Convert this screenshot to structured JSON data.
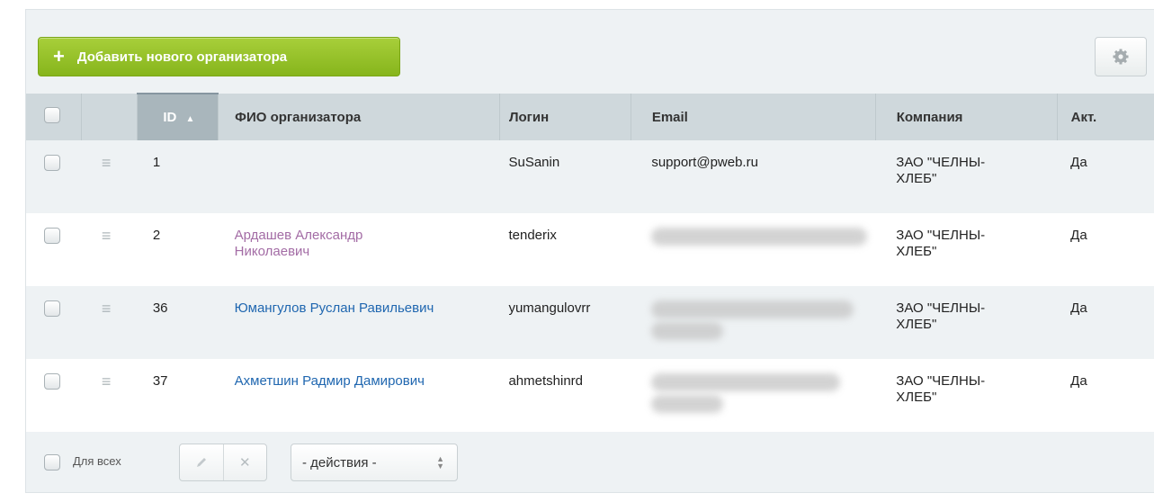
{
  "toolbar": {
    "add_button_label": "Добавить нового организатора",
    "add_button_icon": "plus-icon",
    "settings_icon": "gear-icon"
  },
  "table": {
    "columns": [
      "",
      "",
      "ID",
      "ФИО организатора",
      "Логин",
      "Email",
      "Компания",
      "Акт."
    ],
    "sort_indicator": "▲",
    "rows": [
      {
        "id": "1",
        "name": "",
        "name_visited": false,
        "login": "SuSanin",
        "email": "support@pweb.ru",
        "email_hidden": false,
        "company": "ЗАО \"ЧЕЛНЫ-ХЛЕБ\"",
        "active": "Да"
      },
      {
        "id": "2",
        "name": "Ардашев Александр Николаевич",
        "name_visited": true,
        "login": "tenderix",
        "email": "",
        "email_hidden": true,
        "company": "ЗАО \"ЧЕЛНЫ-ХЛЕБ\"",
        "active": "Да"
      },
      {
        "id": "36",
        "name": "Юмангулов Руслан Равильевич",
        "name_visited": false,
        "login": "yumangulovrr",
        "email": "",
        "email_hidden": true,
        "company": "ЗАО \"ЧЕЛНЫ-ХЛЕБ\"",
        "active": "Да"
      },
      {
        "id": "37",
        "name": "Ахметшин Радмир Дамирович",
        "name_visited": false,
        "login": "ahmetshinrd",
        "email": "",
        "email_hidden": true,
        "company": "ЗАО \"ЧЕЛНЫ-ХЛЕБ\"",
        "active": "Да"
      }
    ]
  },
  "footer": {
    "for_all_label": "Для всех",
    "edit_icon": "pencil-icon",
    "delete_icon": "close-icon",
    "actions_select_value": "- действия -"
  },
  "colors": {
    "add_button": "#86b51c",
    "link": "#2067b0",
    "visited_link": "#a36ca5",
    "header_bg": "#cfd8dc",
    "sorted_header_bg": "#a9b6bc"
  }
}
